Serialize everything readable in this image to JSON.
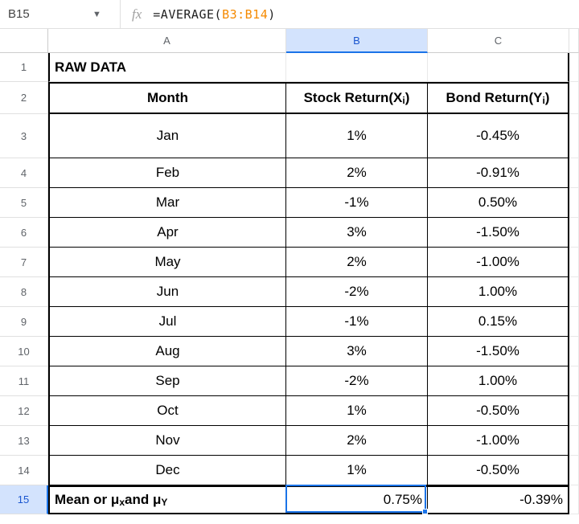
{
  "formula_bar": {
    "cell_ref": "B15",
    "fx_label": "fx",
    "formula_prefix": "=AVERAGE",
    "formula_open": "(",
    "formula_range": "B3:B14",
    "formula_close": ")"
  },
  "columns": {
    "A": "A",
    "B": "B",
    "C": "C"
  },
  "row_numbers": [
    "1",
    "2",
    "3",
    "4",
    "5",
    "6",
    "7",
    "8",
    "9",
    "10",
    "11",
    "12",
    "13",
    "14",
    "15"
  ],
  "active_cell": "B15",
  "headers": {
    "raw_data": "RAW DATA",
    "month": "Month",
    "stock_pre": "Stock Return(X",
    "stock_sub": "i",
    "stock_post": " )",
    "bond_pre": "Bond Return(Y",
    "bond_sub": "i",
    "bond_post": ")"
  },
  "footer": {
    "label_pre": "Mean or μ",
    "label_x_sub": "x",
    "label_mid": " and μ",
    "label_y_sub": "Y",
    "stock_mean": "0.75%",
    "bond_mean": "-0.39%"
  },
  "data": [
    {
      "month": "Jan",
      "stock": "1%",
      "bond": "-0.45%"
    },
    {
      "month": "Feb",
      "stock": "2%",
      "bond": "-0.91%"
    },
    {
      "month": "Mar",
      "stock": "-1%",
      "bond": "0.50%"
    },
    {
      "month": "Apr",
      "stock": "3%",
      "bond": "-1.50%"
    },
    {
      "month": "May",
      "stock": "2%",
      "bond": "-1.00%"
    },
    {
      "month": "Jun",
      "stock": "-2%",
      "bond": "1.00%"
    },
    {
      "month": "Jul",
      "stock": "-1%",
      "bond": "0.15%"
    },
    {
      "month": "Aug",
      "stock": "3%",
      "bond": "-1.50%"
    },
    {
      "month": "Sep",
      "stock": "-2%",
      "bond": "1.00%"
    },
    {
      "month": "Oct",
      "stock": "1%",
      "bond": "-0.50%"
    },
    {
      "month": "Nov",
      "stock": "2%",
      "bond": "-1.00%"
    },
    {
      "month": "Dec",
      "stock": "1%",
      "bond": "-0.50%"
    }
  ]
}
